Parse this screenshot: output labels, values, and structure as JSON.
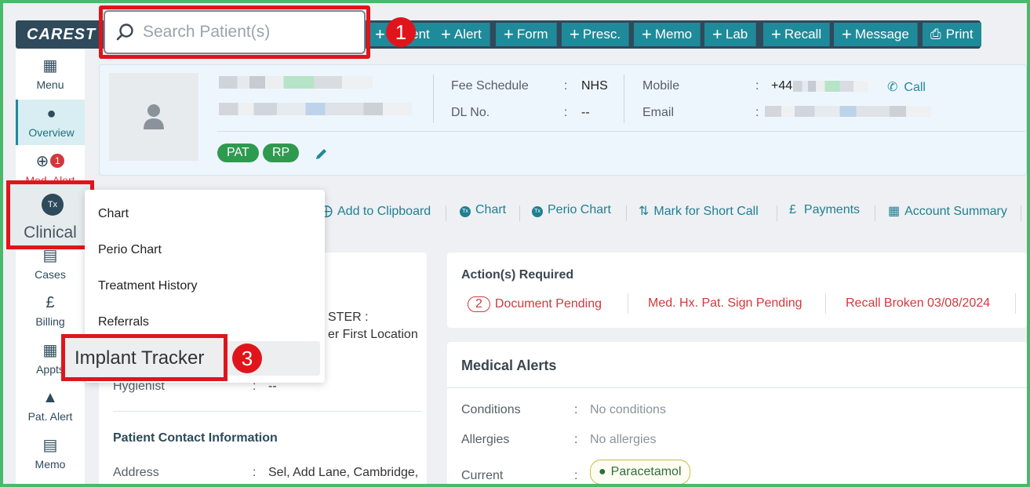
{
  "topbar": {
    "logo_main": "CARE",
    "logo_tail": "ST",
    "search_placeholder": "Search Patient(s)",
    "buttons": [
      {
        "label": "Patient"
      },
      {
        "label": "Alert"
      },
      {
        "label": "Form"
      },
      {
        "label": "Presc."
      },
      {
        "label": "Memo"
      },
      {
        "label": "Lab"
      },
      {
        "label": "Recall"
      },
      {
        "label": "Message"
      },
      {
        "label": "Print"
      }
    ]
  },
  "steps": [
    "1",
    "2",
    "3"
  ],
  "leftnav": {
    "menu": "Menu",
    "overview": "Overview",
    "med_alert": "Med. Alert",
    "med_alert_count": "1",
    "clinical": "Clinical",
    "clinical_icon_text": "Tx",
    "cases": "Cases",
    "billing": "Billing",
    "appts": "Appts",
    "pat_alert": "Pat. Alert",
    "memo": "Memo"
  },
  "patient": {
    "tags": [
      "PAT",
      "RP"
    ],
    "fee_schedule_label": "Fee Schedule",
    "fee_schedule_value": "NHS",
    "dl_label": "DL No.",
    "dl_value": "--",
    "mobile_label": "Mobile",
    "mobile_value": "+44",
    "call_label": "Call",
    "email_label": "Email",
    "colon": ":"
  },
  "actions": [
    {
      "label": "Add to Clipboard"
    },
    {
      "label": "Chart"
    },
    {
      "label": "Perio Chart"
    },
    {
      "label": "Mark for Short Call"
    },
    {
      "label": "Payments"
    },
    {
      "label": "Account Summary"
    }
  ],
  "dropdown": {
    "items": [
      "Chart",
      "Perio Chart",
      "Treatment History",
      "Referrals",
      "Implant Tracker"
    ]
  },
  "left_card": {
    "ster_line": "STER :",
    "location_line": "er First Location",
    "hygienist_label": "Hygienist",
    "hygienist_value": "--",
    "contact_heading": "Patient Contact Information",
    "address_label": "Address",
    "address_value": "Sel, Add Lane, Cambridge,"
  },
  "actions_required": {
    "title": "Action(s) Required",
    "doc_count": "2",
    "doc_label": "Document Pending",
    "medhx_label": "Med. Hx. Pat. Sign Pending",
    "recall_label": "Recall Broken 03/08/2024"
  },
  "medical_alerts": {
    "title": "Medical Alerts",
    "conditions_label": "Conditions",
    "conditions_value": "No conditions",
    "allergies_label": "Allergies",
    "allergies_value": "No allergies",
    "current_label": "Current",
    "current_value": "Paracetamol"
  },
  "colors": {
    "accent": "#1f8a9a",
    "topbar": "#2e4a5b",
    "highlight": "#e0151b",
    "tag_green": "#2e9a4f",
    "alert_red": "#d0393c"
  }
}
